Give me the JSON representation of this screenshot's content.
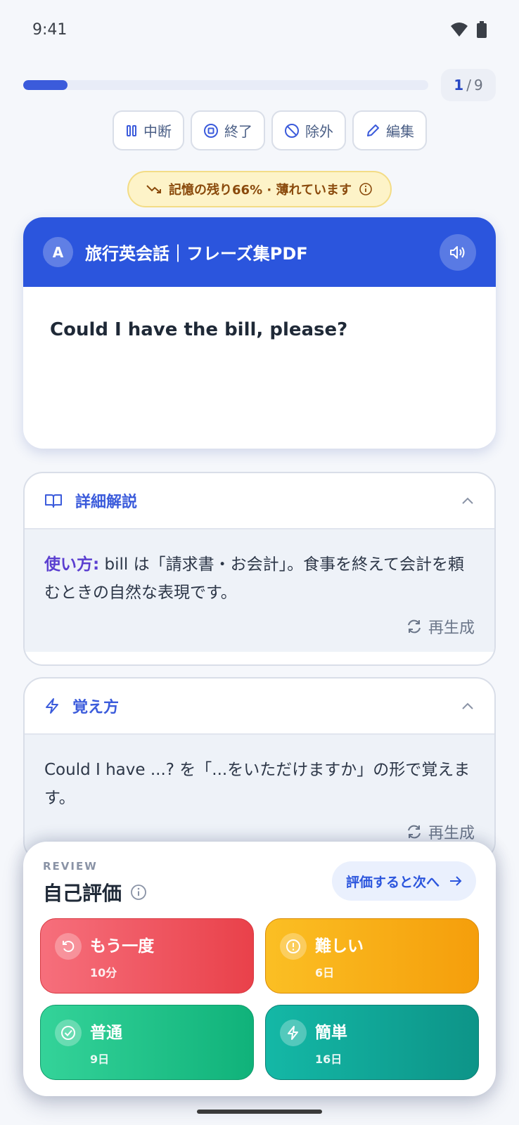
{
  "status_bar": {
    "time": "9:41"
  },
  "progress": {
    "current": "1",
    "separator": "/",
    "total": "9",
    "fraction": 0.11
  },
  "actions": [
    {
      "label": "中断",
      "icon": "pause-icon"
    },
    {
      "label": "終了",
      "icon": "stop-icon"
    },
    {
      "label": "除外",
      "icon": "ban-icon"
    },
    {
      "label": "編集",
      "icon": "pencil-icon"
    }
  ],
  "memory_badge": {
    "text": "記憶の残り66% · 薄れています"
  },
  "card": {
    "avatar": "A",
    "deck": "旅行英会話｜フレーズ集PDF",
    "front": "Could I have the bill, please?"
  },
  "detail_panel": {
    "title": "詳細解説",
    "label": "使い方:",
    "text": "bill は「請求書・お会計」。食事を終えて会計を頼むときの自然な表現です。",
    "regen": "再生成"
  },
  "memo_panel": {
    "title": "覚え方",
    "text": "Could I have ...? を「...をいただけますか」の形で覚えます。",
    "regen": "再生成"
  },
  "review": {
    "eyebrow": "REVIEW",
    "title": "自己評価",
    "next_label": "評価すると次へ",
    "grades": [
      {
        "label": "もう一度",
        "interval": "10分"
      },
      {
        "label": "難しい",
        "interval": "6日"
      },
      {
        "label": "普通",
        "interval": "9日"
      },
      {
        "label": "簡単",
        "interval": "16日"
      }
    ]
  },
  "colors": {
    "accent": "#2b55dd",
    "again": "#e9414a",
    "hard": "#f59e0b",
    "good": "#10b27a",
    "easy": "#0d9488"
  }
}
